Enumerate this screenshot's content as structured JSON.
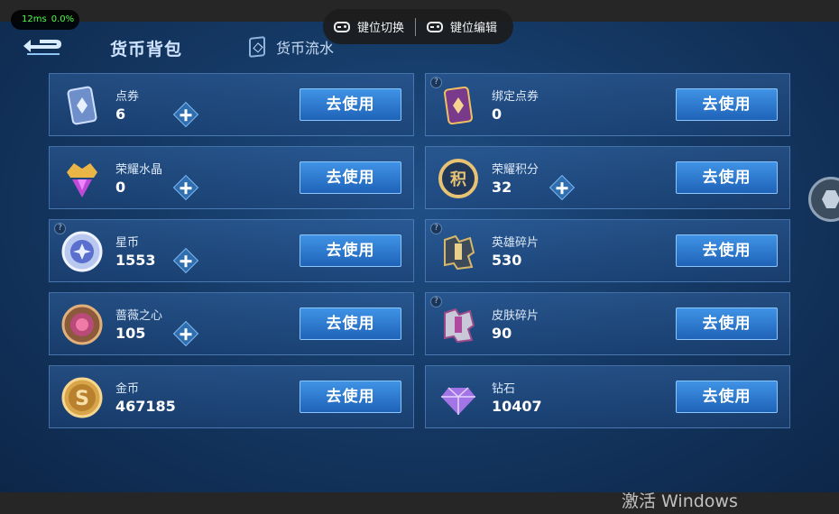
{
  "overlay": {
    "latency": "12ms",
    "usage": "0.0%",
    "key_switch_label": "键位切换",
    "key_edit_label": "键位编辑"
  },
  "header": {
    "active_tab": "货币背包",
    "flow_tab": "货币流水"
  },
  "use_label": "去使用",
  "currencies": [
    {
      "name": "点券",
      "value": "6",
      "icon": "coupon-icon",
      "plus": true,
      "help": false
    },
    {
      "name": "绑定点券",
      "value": "0",
      "icon": "bound-coupon-icon",
      "plus": false,
      "help": true
    },
    {
      "name": "荣耀水晶",
      "value": "0",
      "icon": "glory-crystal-icon",
      "plus": true,
      "help": false
    },
    {
      "name": "荣耀积分",
      "value": "32",
      "icon": "glory-points-icon",
      "plus": true,
      "help": false
    },
    {
      "name": "星币",
      "value": "1553",
      "icon": "star-coin-icon",
      "plus": true,
      "help": true
    },
    {
      "name": "英雄碎片",
      "value": "530",
      "icon": "hero-fragment-icon",
      "plus": false,
      "help": true
    },
    {
      "name": "蔷薇之心",
      "value": "105",
      "icon": "rose-heart-icon",
      "plus": true,
      "help": false
    },
    {
      "name": "皮肤碎片",
      "value": "90",
      "icon": "skin-fragment-icon",
      "plus": false,
      "help": true
    },
    {
      "name": "金币",
      "value": "467185",
      "icon": "gold-coin-icon",
      "plus": false,
      "help": false
    },
    {
      "name": "钻石",
      "value": "10407",
      "icon": "diamond-icon",
      "plus": false,
      "help": false
    }
  ],
  "watermark": "激活 Windows",
  "colors": {
    "button": "#2a7ad0",
    "background": "#153a66",
    "perf_text": "#4cff4c"
  }
}
